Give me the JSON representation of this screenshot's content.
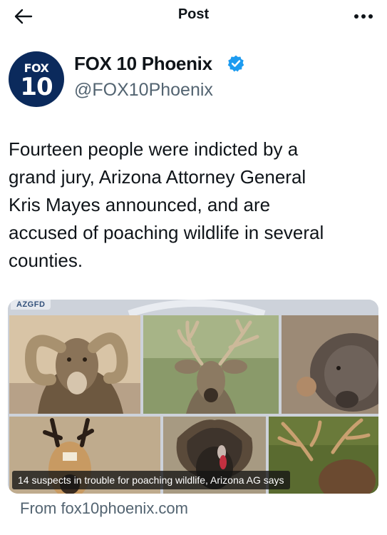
{
  "header": {
    "title": "Post",
    "back_icon": "arrow-left-icon",
    "more_icon": "more-horizontal-icon"
  },
  "author": {
    "avatar_text_top": "FOX",
    "avatar_text_bottom": "10",
    "display_name": "FOX 10 Phoenix",
    "handle": "@FOX10Phoenix",
    "verified_icon": "verified-badge-icon",
    "verified_color": "#1d9bf0"
  },
  "tweet": {
    "lines": [
      "Fourteen people were indicted by a",
      "grand jury, Arizona Attorney General",
      "Kris Mayes announced, and are",
      "accused of poaching wildlife in several",
      "counties."
    ]
  },
  "card": {
    "source_tag": "AZGFD",
    "caption": "14 suspects in trouble for poaching wildlife, Arizona AG says",
    "tiles": [
      "bighorn-sheep",
      "mule-deer",
      "javelina",
      "pronghorn",
      "wild-turkey",
      "elk"
    ]
  },
  "link": {
    "from_text": "From fox10phoenix.com"
  }
}
